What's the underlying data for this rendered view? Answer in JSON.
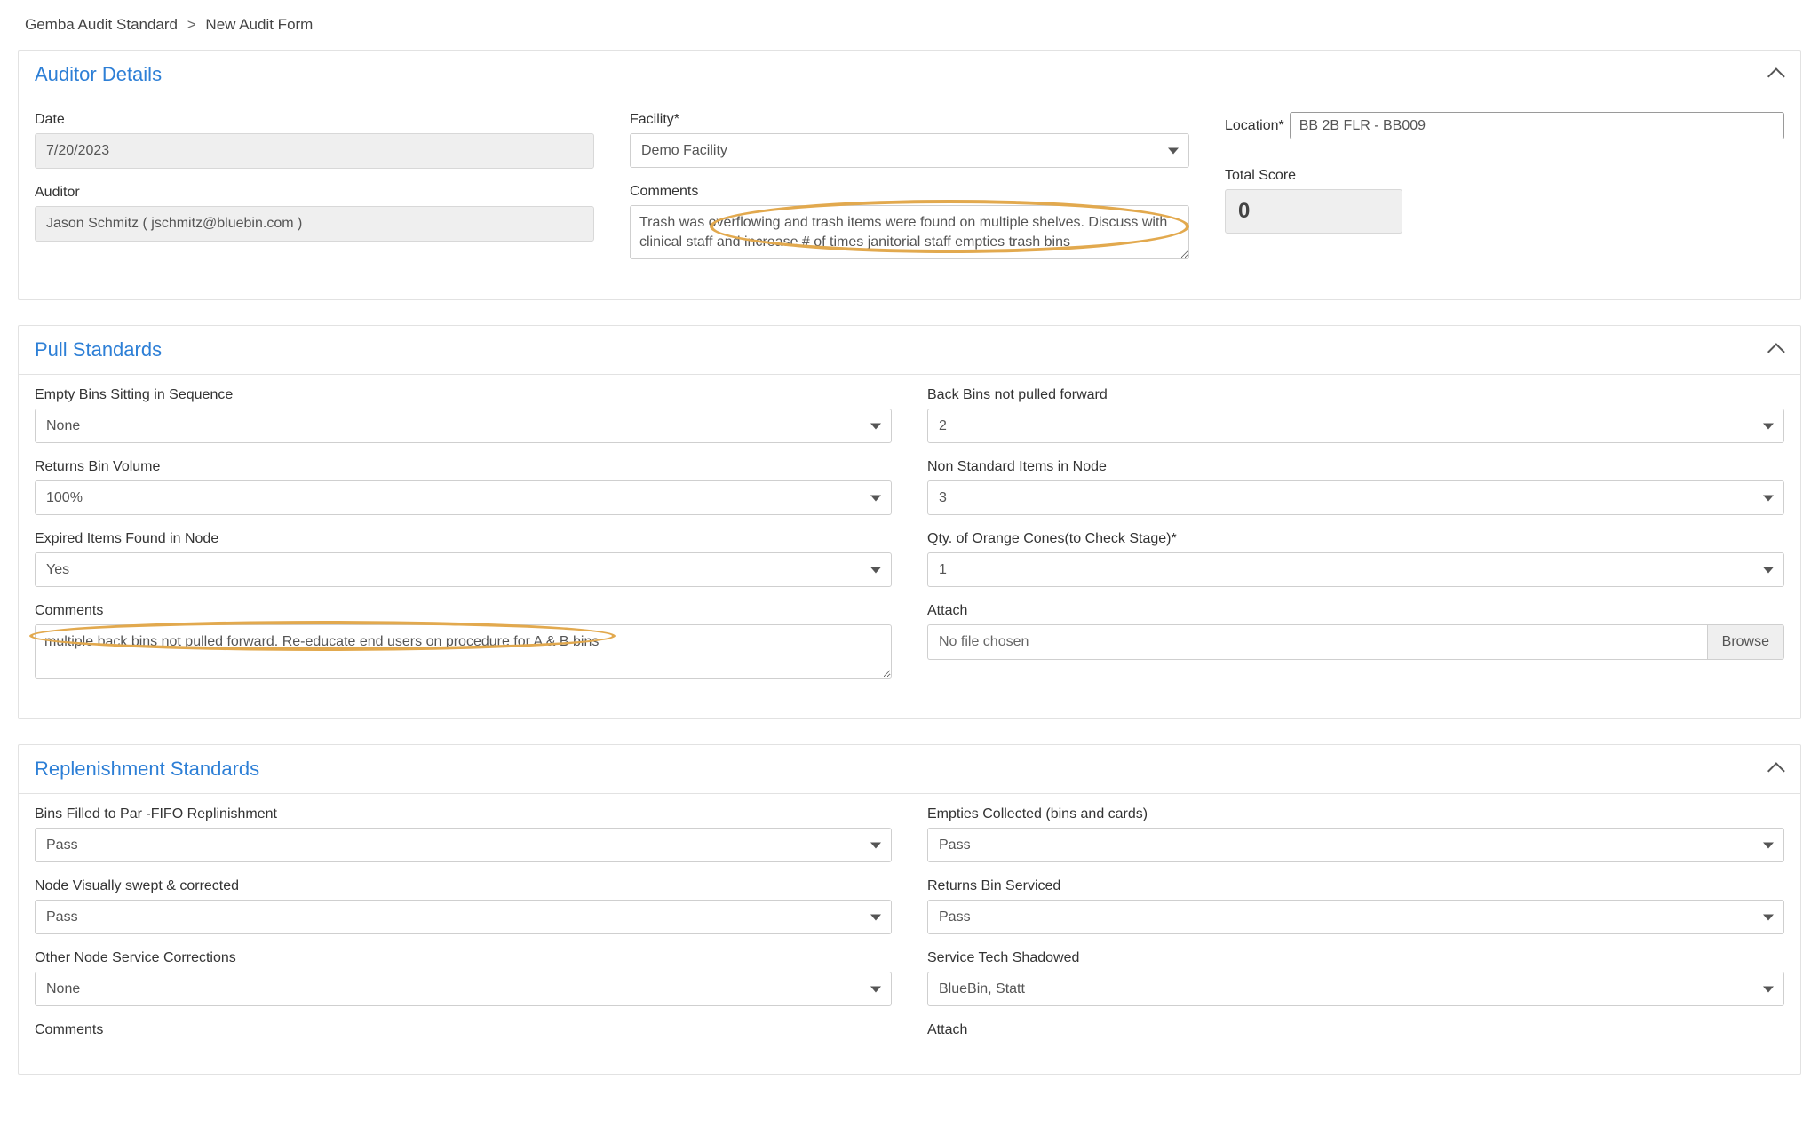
{
  "breadcrumb": {
    "root": "Gemba Audit Standard",
    "current": "New Audit Form"
  },
  "auditorDetails": {
    "title": "Auditor Details",
    "dateLabel": "Date",
    "dateValue": "7/20/2023",
    "auditorLabel": "Auditor",
    "auditorValue": "Jason Schmitz ( jschmitz@bluebin.com )",
    "facilityLabel": "Facility",
    "facilityValue": "Demo Facility",
    "commentsLabel": "Comments",
    "commentsValue": "Trash was overflowing and trash items were found on multiple shelves. Discuss with clinical staff and increase # of times janitorial staff empties trash bins",
    "locationLabel": "Location",
    "locationValue": "BB 2B FLR - BB009",
    "totalScoreLabel": "Total Score",
    "totalScoreValue": "0"
  },
  "pullStandards": {
    "title": "Pull Standards",
    "emptyBinsLabel": "Empty Bins Sitting in Sequence",
    "emptyBinsValue": "None",
    "returnsVolLabel": "Returns Bin Volume",
    "returnsVolValue": "100%",
    "expiredLabel": "Expired Items Found in Node",
    "expiredValue": "Yes",
    "commentsLabel": "Comments",
    "commentsValue": "multiple back bins not pulled forward. Re-educate end users on procedure for A & B bins",
    "backBinsLabel": "Back Bins not pulled forward",
    "backBinsValue": "2",
    "nonStdLabel": "Non Standard Items in Node",
    "nonStdValue": "3",
    "conesLabel": "Qty. of Orange Cones(to Check Stage)",
    "conesValue": "1",
    "attachLabel": "Attach",
    "attachValue": "No file chosen",
    "browseLabel": "Browse"
  },
  "replenishment": {
    "title": "Replenishment Standards",
    "fifoLabel": "Bins Filled to Par -FIFO Replinishment",
    "fifoValue": "Pass",
    "sweptLabel": "Node Visually swept & corrected",
    "sweptValue": "Pass",
    "otherLabel": "Other Node Service Corrections",
    "otherValue": "None",
    "commentsLabel": "Comments",
    "emptiesLabel": "Empties Collected (bins and cards)",
    "emptiesValue": "Pass",
    "returnsLabel": "Returns Bin Serviced",
    "returnsValue": "Pass",
    "shadowLabel": "Service Tech Shadowed",
    "shadowValue": "BlueBin, Statt",
    "attachLabel": "Attach"
  }
}
